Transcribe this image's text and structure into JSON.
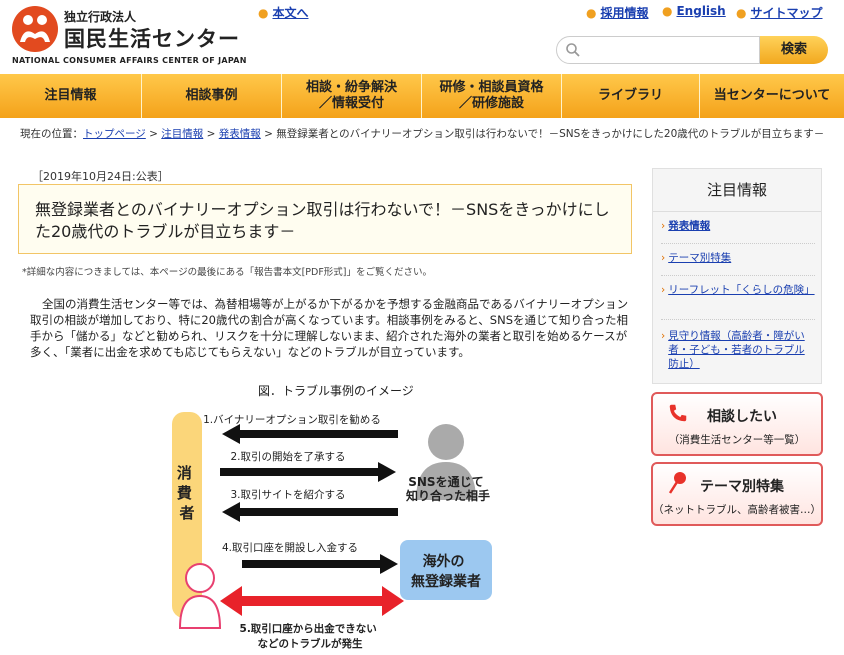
{
  "header": {
    "org_type": "独立行政法人",
    "org_name": "国民生活センター",
    "org_name_en": "NATIONAL CONSUMER AFFAIRS CENTER OF JAPAN",
    "skip_link": "本文へ",
    "links": [
      "採用情報",
      "English",
      "サイトマップ"
    ],
    "search_placeholder": "",
    "search_button": "検索"
  },
  "nav": [
    "注目情報",
    "相談事例",
    "相談・紛争解決\n／情報受付",
    "研修・相談員資格\n／研修施設",
    "ライブラリ",
    "当センターについて"
  ],
  "breadcrumb": {
    "prefix": "現在の位置：",
    "items": [
      "トップページ",
      "注目情報",
      "発表情報"
    ],
    "current": "無登録業者とのバイナリーオプション取引は行わないで！－SNSをきっかけにした20歳代のトラブルが目立ちます－"
  },
  "article": {
    "date": "［2019年10月24日:公表］",
    "title": "無登録業者とのバイナリーオプション取引は行わないで！－SNSをきっかけにした20歳代のトラブルが目立ちます－",
    "note": "*詳細な内容につきましては、本ページの最後にある「報告書本文[PDF形式]」をご覧ください。",
    "body": "全国の消費生活センター等では、為替相場等が上がるか下がるかを予想する金融商品であるバイナリーオプション取引の相談が増加しており、特に20歳代の割合が高くなっています。相談事例をみると、SNSを通じて知り合った相手から「儲かる」などと勧められ、リスクを十分に理解しないまま、紹介された海外の業者と取引を始めるケースが多く、「業者に出金を求めても応じてもらえない」などのトラブルが目立っています。"
  },
  "figure": {
    "caption": "図．トラブル事例のイメージ",
    "consumer": "消費者",
    "sns_partner": "SNSを通じて\n知り合った相手",
    "overseas": "海外の\n無登録業者",
    "steps": [
      "1.バイナリーオプション取引を勧める",
      "2.取引の開始を了承する",
      "3.取引サイトを紹介する",
      "4.取引口座を開設し入金する",
      "5.取引口座から出金できない\nなどのトラブルが発生"
    ]
  },
  "sidebar": {
    "heading": "注目情報",
    "items": [
      "発表情報",
      "テーマ別特集",
      "リーフレット「くらしの危険」",
      "見守り情報（高齢者・障がい者・子ども・若者のトラブル防止）"
    ],
    "consult_title": "相談したい",
    "consult_sub": "（消費生活センター等一覧）",
    "theme_title": "テーマ別特集",
    "theme_sub": "（ネットトラブル、高齢者被害…）"
  },
  "colors": {
    "accent": "#f4a21a",
    "brand": "#e24a1f",
    "consumer_bar": "#fbd67a",
    "arrow_red": "#e8222a",
    "overseas_box": "#9cc8f0"
  }
}
